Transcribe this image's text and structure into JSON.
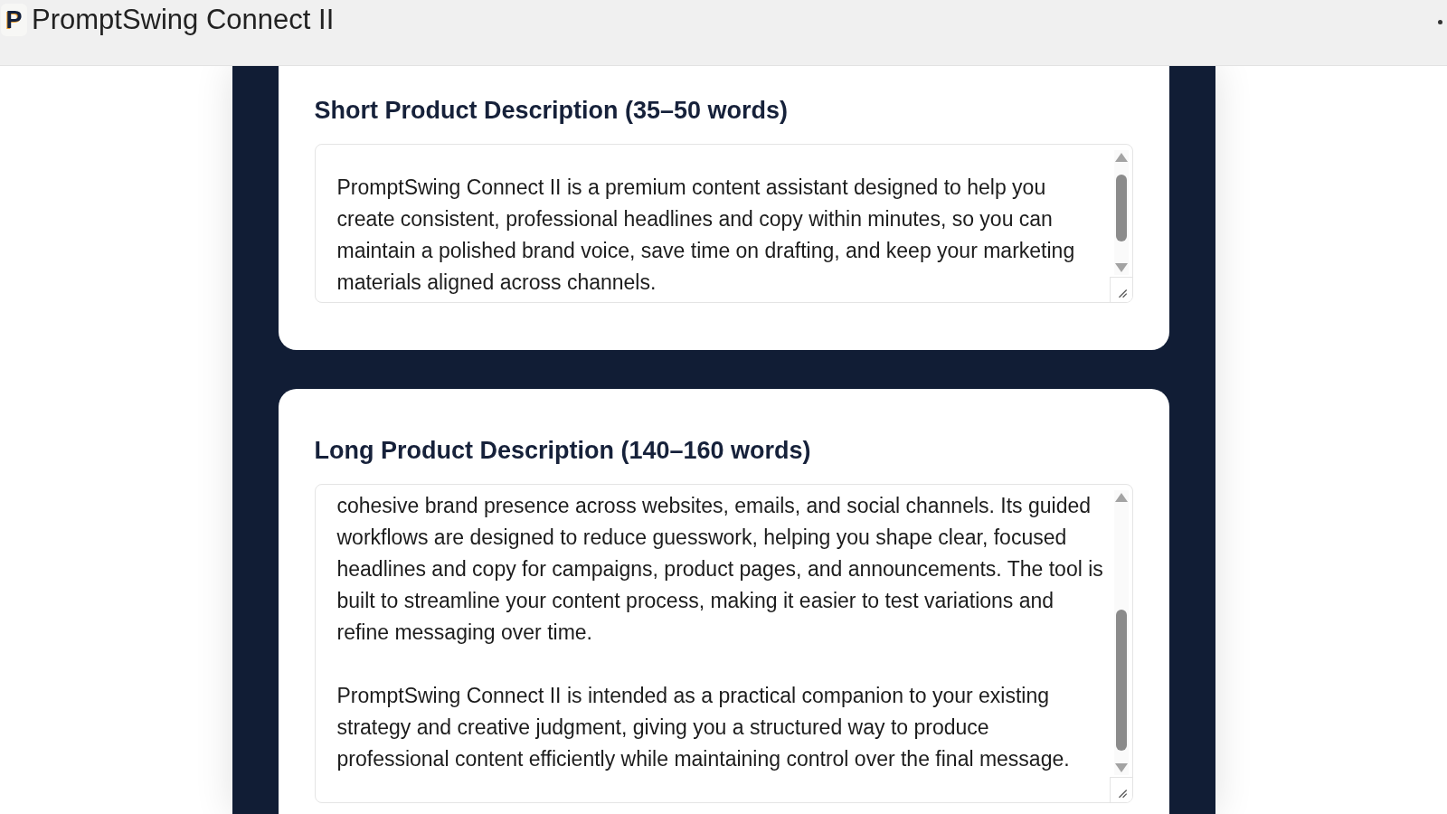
{
  "app_bar": {
    "logo": "P",
    "title": "PromptSwing Connect II"
  },
  "sections": [
    {
      "heading": "Short Product Description (35–50 words)",
      "text": "PromptSwing Connect II is a premium content assistant designed to help you create consistent, professional headlines and copy within minutes, so you can maintain a polished brand voice, save time on drafting, and keep your marketing materials aligned across channels."
    },
    {
      "heading": "Long Product Description (140–160 words)",
      "text": "cohesive brand presence across websites, emails, and social channels. Its guided workflows are designed to reduce guesswork, helping you shape clear, focused headlines and copy for campaigns, product pages, and announcements. The tool is built to streamline your content process, making it easier to test variations and refine messaging over time.\n\nPromptSwing Connect II is intended as a practical companion to your existing strategy and creative judgment, giving you a structured way to produce professional content efficiently while maintaining control over the final message."
    }
  ]
}
